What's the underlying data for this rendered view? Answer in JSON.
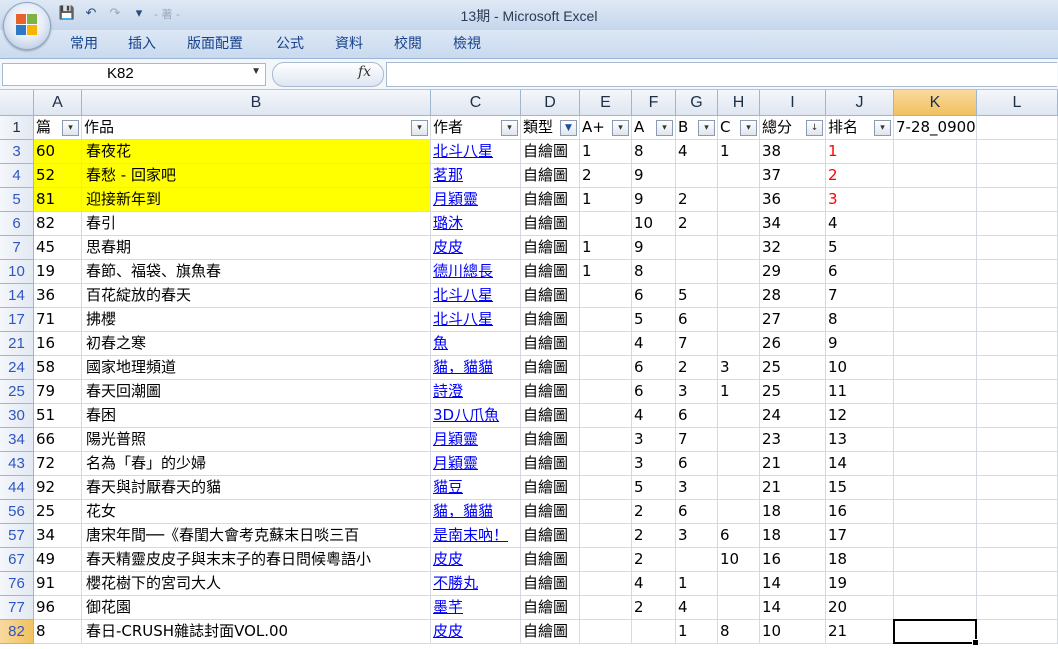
{
  "window": {
    "title": "13期 - Microsoft Excel"
  },
  "quick_access": {
    "ghost_text": "- 著 -"
  },
  "ribbon_tabs": [
    "常用",
    "插入",
    "版面配置",
    "公式",
    "資料",
    "校閱",
    "檢視"
  ],
  "formula_bar": {
    "name_box": "K82",
    "fx": "fx",
    "formula": ""
  },
  "columns": [
    "A",
    "B",
    "C",
    "D",
    "E",
    "F",
    "G",
    "H",
    "I",
    "J",
    "K",
    "L"
  ],
  "header_row": {
    "row_number": "1",
    "cells": [
      "篇",
      "作品",
      "作者",
      "類型",
      "A+",
      "A",
      "B",
      "C",
      "總分",
      "排名",
      "7-28_0900",
      ""
    ]
  },
  "rows": [
    {
      "rn": "3",
      "a": "60",
      "b": "春夜花",
      "c": "北斗八星",
      "d": "自繪圖",
      "e": "1",
      "f": "8",
      "g": "4",
      "h": "1",
      "i": "38",
      "j": "1",
      "hl": true,
      "red": true
    },
    {
      "rn": "4",
      "a": "52",
      "b": "春愁 - 回家吧",
      "c": "茗那",
      "d": "自繪圖",
      "e": "2",
      "f": "9",
      "g": "",
      "h": "",
      "i": "37",
      "j": "2",
      "hl": true,
      "red": true
    },
    {
      "rn": "5",
      "a": "81",
      "b": "迎接新年到",
      "c": "月穎靈",
      "d": "自繪圖",
      "e": "1",
      "f": "9",
      "g": "2",
      "h": "",
      "i": "36",
      "j": "3",
      "hl": true,
      "red": true
    },
    {
      "rn": "6",
      "a": "82",
      "b": "春引",
      "c": "璐沐",
      "d": "自繪圖",
      "e": "",
      "f": "10",
      "g": "2",
      "h": "",
      "i": "34",
      "j": "4"
    },
    {
      "rn": "7",
      "a": "45",
      "b": "思春期",
      "c": "皮皮",
      "d": "自繪圖",
      "e": "1",
      "f": "9",
      "g": "",
      "h": "",
      "i": "32",
      "j": "5"
    },
    {
      "rn": "10",
      "a": "19",
      "b": "春節、福袋、旗魚春",
      "c": "德川總長",
      "d": "自繪圖",
      "e": "1",
      "f": "8",
      "g": "",
      "h": "",
      "i": "29",
      "j": "6"
    },
    {
      "rn": "14",
      "a": "36",
      "b": "百花綻放的春天",
      "c": "北斗八星",
      "d": "自繪圖",
      "e": "",
      "f": "6",
      "g": "5",
      "h": "",
      "i": "28",
      "j": "7"
    },
    {
      "rn": "17",
      "a": "71",
      "b": "拂櫻",
      "c": "北斗八星",
      "d": "自繪圖",
      "e": "",
      "f": "5",
      "g": "6",
      "h": "",
      "i": "27",
      "j": "8"
    },
    {
      "rn": "21",
      "a": "16",
      "b": "初春之寒",
      "c": "魚",
      "d": "自繪圖",
      "e": "",
      "f": "4",
      "g": "7",
      "h": "",
      "i": "26",
      "j": "9"
    },
    {
      "rn": "24",
      "a": "58",
      "b": "國家地理頻道",
      "c": "貓，貓貓",
      "d": "自繪圖",
      "e": "",
      "f": "6",
      "g": "2",
      "h": "3",
      "i": "25",
      "j": "10"
    },
    {
      "rn": "25",
      "a": "79",
      "b": "春天回潮圖",
      "c": "詩澄",
      "d": "自繪圖",
      "e": "",
      "f": "6",
      "g": "3",
      "h": "1",
      "i": "25",
      "j": "11"
    },
    {
      "rn": "30",
      "a": "51",
      "b": "春困",
      "c": "3D八爪魚",
      "d": "自繪圖",
      "e": "",
      "f": "4",
      "g": "6",
      "h": "",
      "i": "24",
      "j": "12"
    },
    {
      "rn": "34",
      "a": "66",
      "b": "陽光普照",
      "c": "月穎靈",
      "d": "自繪圖",
      "e": "",
      "f": "3",
      "g": "7",
      "h": "",
      "i": "23",
      "j": "13"
    },
    {
      "rn": "43",
      "a": "72",
      "b": "名為「春」的少婦",
      "c": "月穎靈",
      "d": "自繪圖",
      "e": "",
      "f": "3",
      "g": "6",
      "h": "",
      "i": "21",
      "j": "14"
    },
    {
      "rn": "44",
      "a": "92",
      "b": "春天與討厭春天的貓",
      "c": "貓豆",
      "d": "自繪圖",
      "e": "",
      "f": "5",
      "g": "3",
      "h": "",
      "i": "21",
      "j": "15"
    },
    {
      "rn": "56",
      "a": "25",
      "b": "花女",
      "c": "貓，貓貓",
      "d": "自繪圖",
      "e": "",
      "f": "2",
      "g": "6",
      "h": "",
      "i": "18",
      "j": "16"
    },
    {
      "rn": "57",
      "a": "34",
      "b": "唐宋年間──《春閨大會考克蘇末日啖三百",
      "c": "是南末吶！",
      "d": "自繪圖",
      "e": "",
      "f": "2",
      "g": "3",
      "h": "6",
      "i": "18",
      "j": "17"
    },
    {
      "rn": "67",
      "a": "49",
      "b": "春天精靈皮皮子與末末子的春日問候粵語小",
      "c": "皮皮",
      "d": "自繪圖",
      "e": "",
      "f": "2",
      "g": "",
      "h": "10",
      "i": "16",
      "j": "18"
    },
    {
      "rn": "76",
      "a": "91",
      "b": "櫻花樹下的宮司大人",
      "c": "不勝丸",
      "d": "自繪圖",
      "e": "",
      "f": "4",
      "g": "1",
      "h": "",
      "i": "14",
      "j": "19"
    },
    {
      "rn": "77",
      "a": "96",
      "b": "御花園",
      "c": "墨芊",
      "d": "自繪圖",
      "e": "",
      "f": "2",
      "g": "4",
      "h": "",
      "i": "14",
      "j": "20"
    },
    {
      "rn": "82",
      "a": "8",
      "b": "春日-CRUSH雜誌封面VOL.00",
      "c": "皮皮",
      "d": "自繪圖",
      "e": "",
      "f": "",
      "g": "1",
      "h": "8",
      "i": "10",
      "j": "21"
    }
  ]
}
